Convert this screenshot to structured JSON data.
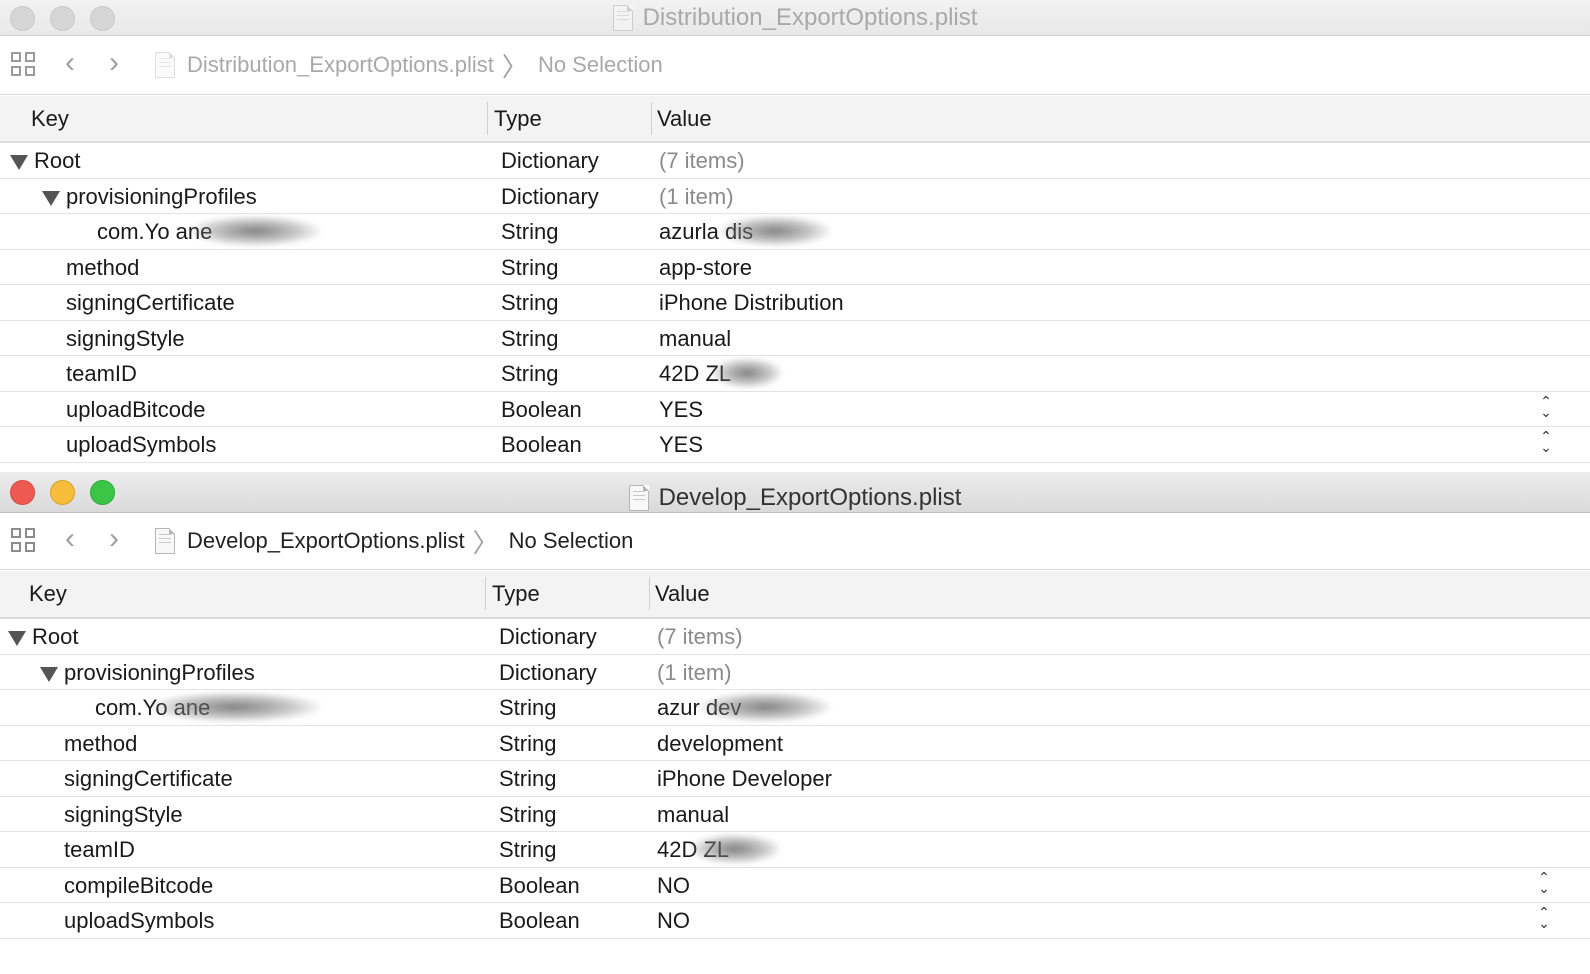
{
  "windows": [
    {
      "title": "Distribution_ExportOptions.plist",
      "breadcrumb": {
        "file": "Distribution_ExportOptions.plist",
        "selection": "No Selection"
      },
      "columns": {
        "key": "Key",
        "type": "Type",
        "value": "Value"
      },
      "rows": [
        {
          "key": "Root",
          "type": "Dictionary",
          "value": "(7 items)",
          "level": 0,
          "expanded": true
        },
        {
          "key": "provisioningProfiles",
          "type": "Dictionary",
          "value": "(1 item)",
          "level": 1,
          "expanded": true
        },
        {
          "key": "com.Yo               ane",
          "type": "String",
          "value": "azurla            dis",
          "level": 2
        },
        {
          "key": "method",
          "type": "String",
          "value": "app-store",
          "level": 1
        },
        {
          "key": "signingCertificate",
          "type": "String",
          "value": "iPhone Distribution",
          "level": 1
        },
        {
          "key": "signingStyle",
          "type": "String",
          "value": "manual",
          "level": 1
        },
        {
          "key": "teamID",
          "type": "String",
          "value": "42D          ZL",
          "level": 1
        },
        {
          "key": "uploadBitcode",
          "type": "Boolean",
          "value": "YES",
          "level": 1
        },
        {
          "key": "uploadSymbols",
          "type": "Boolean",
          "value": "YES",
          "level": 1
        }
      ]
    },
    {
      "title": "Develop_ExportOptions.plist",
      "breadcrumb": {
        "file": "Develop_ExportOptions.plist",
        "selection": "No Selection"
      },
      "columns": {
        "key": "Key",
        "type": "Type",
        "value": "Value"
      },
      "rows": [
        {
          "key": "Root",
          "type": "Dictionary",
          "value": "(7 items)",
          "level": 0,
          "expanded": true
        },
        {
          "key": "provisioningProfiles",
          "type": "Dictionary",
          "value": "(1 item)",
          "level": 1,
          "expanded": true
        },
        {
          "key": "com.Yo               ane",
          "type": "String",
          "value": "azur              dev",
          "level": 2
        },
        {
          "key": "method",
          "type": "String",
          "value": "development",
          "level": 1
        },
        {
          "key": "signingCertificate",
          "type": "String",
          "value": "iPhone Developer",
          "level": 1
        },
        {
          "key": "signingStyle",
          "type": "String",
          "value": "manual",
          "level": 1
        },
        {
          "key": "teamID",
          "type": "String",
          "value": "42D          ZL",
          "level": 1
        },
        {
          "key": "compileBitcode",
          "type": "Boolean",
          "value": "NO",
          "level": 1
        },
        {
          "key": "uploadSymbols",
          "type": "Boolean",
          "value": "NO",
          "level": 1
        }
      ]
    }
  ],
  "icons": {
    "window_close": "close-icon",
    "window_minimize": "minimize-icon",
    "window_zoom": "zoom-icon",
    "related_items": "grid-icon",
    "back": "chevron-left-icon",
    "forward": "chevron-right-icon",
    "file": "plist-file-icon",
    "stepper": "up-down-stepper-icon"
  },
  "colors": {
    "close": "#ee5a52",
    "minimize": "#f5bd3a",
    "zoom": "#3cc447",
    "inactive_control": "#d6d6d6",
    "header_bg": "#f3f3f3"
  }
}
